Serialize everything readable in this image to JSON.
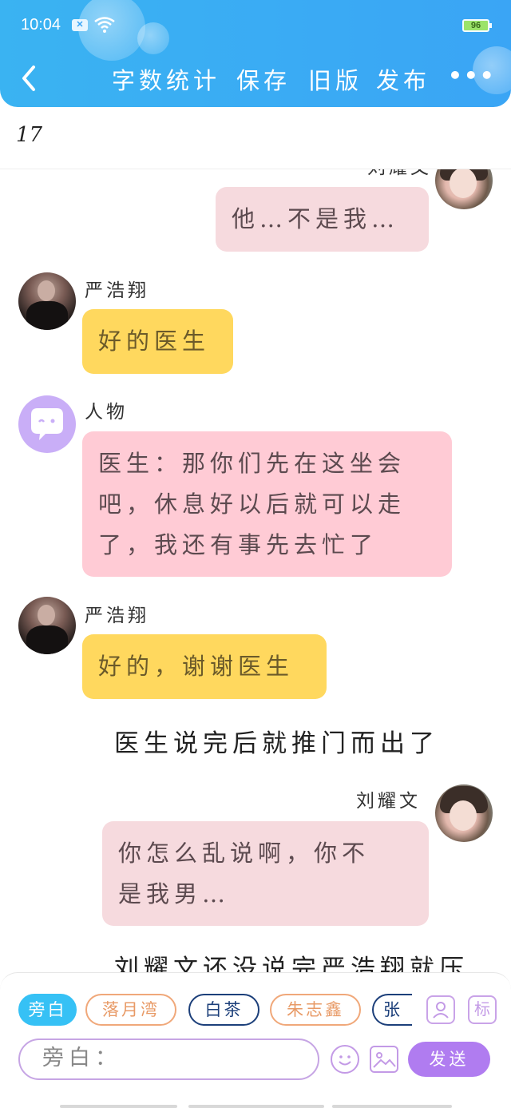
{
  "status_bar": {
    "time": "10:04",
    "battery": "96"
  },
  "toolbar": {
    "items": [
      "字数统计",
      "保存",
      "旧版",
      "发布"
    ],
    "more": "•••"
  },
  "word_count": "17",
  "messages": [
    {
      "side": "right",
      "name": "刘耀文",
      "text": "他…不是我…",
      "bubble": "rose",
      "avatar": "girl"
    },
    {
      "side": "left",
      "name": "严浩翔",
      "text": "好的医生",
      "bubble": "yellow",
      "avatar": "person"
    },
    {
      "side": "left",
      "name": "人物",
      "lines": [
        "医生：那你们先在这坐会",
        "吧，休息好以后就可以走",
        "了，我还有事先去忙了"
      ],
      "bubble": "pink",
      "avatar": "bubble-icon"
    },
    {
      "side": "left",
      "name": "严浩翔",
      "text": "好的，谢谢医生",
      "bubble": "yellow",
      "avatar": "person"
    },
    {
      "side": "center",
      "text": "医生说完后就推门而出了"
    },
    {
      "side": "right",
      "name": "刘耀文",
      "lines": [
        "你怎么乱说啊，你不",
        "是我男…"
      ],
      "bubble": "rose",
      "avatar": "girl"
    },
    {
      "side": "center",
      "text": "刘耀文还没说完严浩翔就压"
    }
  ],
  "roles": [
    "旁白",
    "落月湾",
    "白茶",
    "朱志鑫",
    "张"
  ],
  "side_icons": [
    "profile-icon",
    "tag-icon"
  ],
  "tag_label": "标",
  "input": {
    "value": "旁白："
  },
  "send_label": "发送",
  "colors": {
    "header": "#3aa5f5",
    "yellow_bubble": "#ffd85e",
    "pink_bubble": "#ffcbd5",
    "rose_bubble": "#f6dade",
    "send": "#b07cf0",
    "active_role": "#36c1f5"
  }
}
